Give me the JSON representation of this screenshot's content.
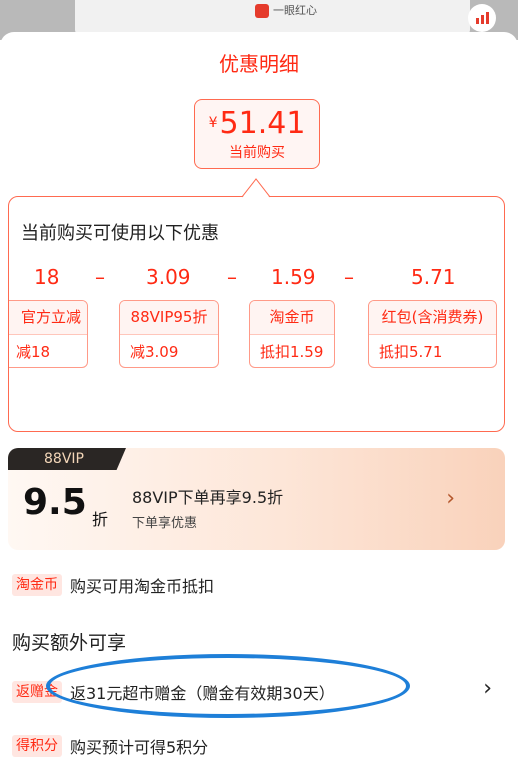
{
  "background": {
    "banner_text": "一眼红心"
  },
  "sheet": {
    "title": "优惠明细",
    "price": {
      "currency": "¥",
      "value": "51.41",
      "label": "当前购买"
    }
  },
  "discounts": {
    "title": "当前购买可使用以下优惠",
    "amounts": [
      "18",
      "3.09",
      "1.59",
      "5.71"
    ],
    "minus_sign": "–",
    "items": [
      {
        "name": "官方立减",
        "detail": "减18"
      },
      {
        "name": "88VIP95折",
        "detail": "减3.09"
      },
      {
        "name": "淘金币",
        "detail": "抵扣1.59"
      },
      {
        "name": "红包(含消费券)",
        "detail": "抵扣5.71"
      }
    ]
  },
  "vip": {
    "tag": "88VIP",
    "rate": "9.5",
    "unit": "折",
    "main_text": "88VIP下单再享9.5折",
    "sub_text": "下单享优惠",
    "arrow": "›"
  },
  "taojinbi": {
    "badge": "淘金币",
    "text": "购买可用淘金币抵扣"
  },
  "extra": {
    "title": "购买额外可享",
    "rows": [
      {
        "badge": "返赠金",
        "text": "返31元超市赠金（赠金有效期30天）",
        "arrow": "›"
      },
      {
        "badge": "得积分",
        "text": "购买预计可得5积分"
      }
    ]
  },
  "colors": {
    "accent": "#ff2a14",
    "annotation": "#1e7fd8"
  }
}
